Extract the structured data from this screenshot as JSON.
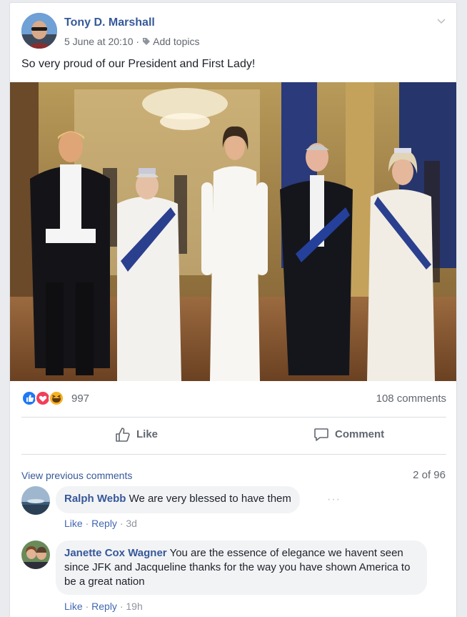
{
  "post": {
    "author": "Tony D. Marshall",
    "time": "5 June at 20:10",
    "separator": "·",
    "add_topics": "Add topics",
    "text": "So very proud of our President and First Lady!"
  },
  "stats": {
    "reaction_count": "997",
    "comments_count": "108 comments",
    "reactions": [
      "like",
      "love",
      "haha"
    ]
  },
  "actions": {
    "like": "Like",
    "comment": "Comment"
  },
  "comments": {
    "view_previous": "View previous comments",
    "pager": "2 of 96",
    "items": [
      {
        "name": "Ralph Webb",
        "text": "We are very blessed to have them",
        "like": "Like",
        "reply": "Reply",
        "time": "3d"
      },
      {
        "name": "Janette Cox Wagner",
        "text": "You are the essence of elegance we havent seen since JFK and Jacqueline thanks for the way you have shown America to be a great nation",
        "like": "Like",
        "reply": "Reply",
        "time": "19h"
      }
    ]
  },
  "colors": {
    "link": "#365899",
    "like_blue": "#2078f4",
    "love_red": "#f33e58",
    "haha_yellow": "#f7b125"
  }
}
